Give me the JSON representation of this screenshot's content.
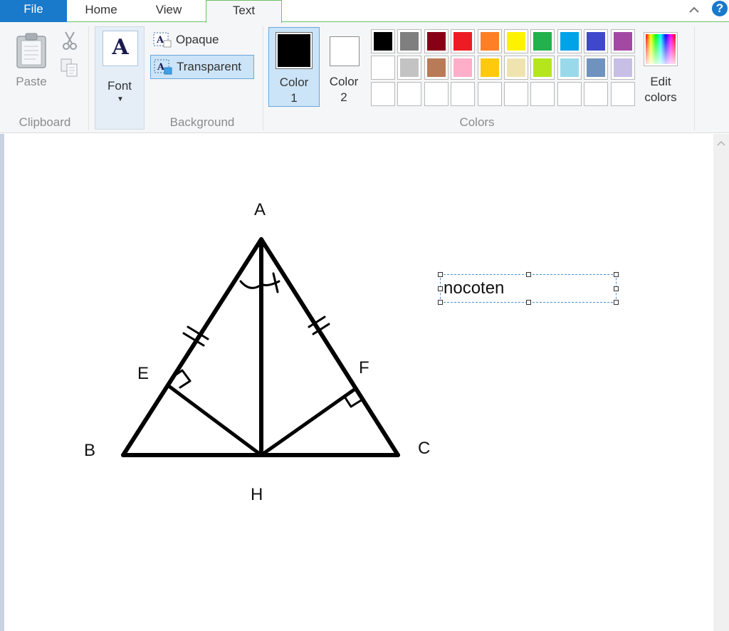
{
  "tabs": {
    "file": "File",
    "home": "Home",
    "view": "View",
    "text": "Text"
  },
  "help": "?",
  "clipboard": {
    "paste": "Paste",
    "group": "Clipboard"
  },
  "font": {
    "label": "Font",
    "icon_letter": "A",
    "dropdown": "▼"
  },
  "background": {
    "opaque": "Opaque",
    "transparent": "Transparent",
    "group": "Background"
  },
  "colors": {
    "color1_line1": "Color",
    "color1_line2": "1",
    "color2_line1": "Color",
    "color2_line2": "2",
    "edit_line1": "Edit",
    "edit_line2": "colors",
    "group": "Colors",
    "color1_value": "#000000",
    "color2_value": "#ffffff",
    "row1": [
      "#000000",
      "#7f7f7f",
      "#880015",
      "#ed1c24",
      "#ff7f27",
      "#fff200",
      "#22b14c",
      "#00a2e8",
      "#3f48cc",
      "#a349a4"
    ],
    "row2": [
      "#ffffff",
      "#c3c3c3",
      "#b97a57",
      "#ffaec9",
      "#ffc90e",
      "#efe4b0",
      "#b5e61d",
      "#99d9ea",
      "#7092be",
      "#c8bfe7"
    ]
  },
  "drawing": {
    "labels": {
      "A": "A",
      "B": "B",
      "C": "C",
      "E": "E",
      "F": "F",
      "H": "H"
    },
    "textbox": "nocoten"
  }
}
